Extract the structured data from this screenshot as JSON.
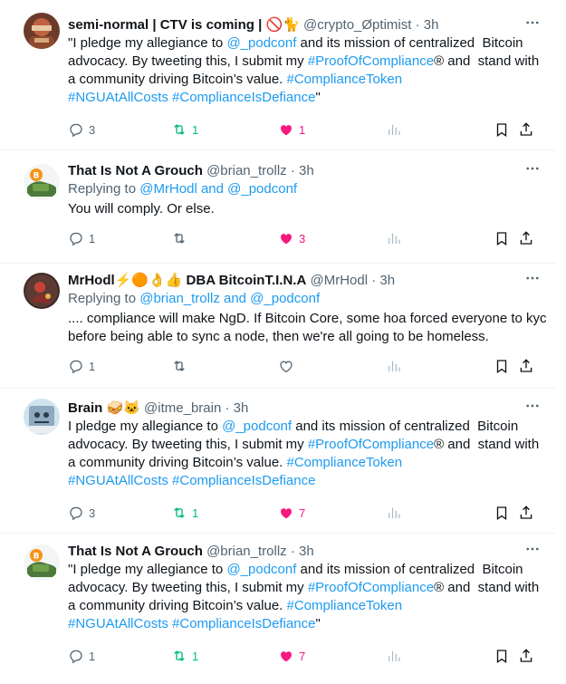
{
  "tweets": [
    {
      "name": "semi-normal | CTV is coming | 🚫🐈",
      "handle": "@crypto_Øptimist",
      "dot": "·",
      "time": "3h",
      "replying_prefix": "",
      "replying_users": "",
      "body": [
        {
          "t": "\"I pledge my allegiance to ",
          "link": false
        },
        {
          "t": "@_podconf",
          "link": true
        },
        {
          "t": " and its mission of centralized  Bitcoin advocacy. By tweeting this, I submit my ",
          "link": false
        },
        {
          "t": "#ProofOfCompliance",
          "link": true
        },
        {
          "t": "® and  stand with a community driving Bitcoin’s value. ",
          "link": false
        },
        {
          "t": "#ComplianceToken",
          "link": true
        },
        {
          "t": "\n",
          "link": false
        },
        {
          "t": "#NGUAtAllCosts",
          "link": true
        },
        {
          "t": " ",
          "link": false
        },
        {
          "t": "#ComplianceIsDefiance",
          "link": true
        },
        {
          "t": "\"",
          "link": false
        }
      ],
      "replies": "3",
      "retweets": "1",
      "likes": "1",
      "liked": true,
      "retweeted": true,
      "avatar": "brown-knight-avatar"
    },
    {
      "name": "That Is Not A Grouch",
      "handle": "@brian_trollz",
      "dot": "·",
      "time": "3h",
      "replying_prefix": "Replying to ",
      "replying_users": "@MrHodl and @_podconf",
      "body": [
        {
          "t": "You will comply. Or else.",
          "link": false
        }
      ],
      "replies": "1",
      "retweets": "",
      "likes": "3",
      "liked": true,
      "retweeted": false,
      "avatar": "grouch-bitcoin-avatar"
    },
    {
      "name": "MrHodl⚡🟠👌👍 DBA BitcoinT.I.N.A",
      "handle": "@MrHodl",
      "dot": "·",
      "time": "3h",
      "replying_prefix": "Replying to ",
      "replying_users": "@brian_trollz and @_podconf",
      "body": [
        {
          "t": ".... compliance will make NgD. If Bitcoin Core, some hoa forced everyone to kyc before being able to sync a node, then we're all going to be homeless.",
          "link": false
        }
      ],
      "replies": "1",
      "retweets": "",
      "likes": "",
      "liked": false,
      "retweeted": false,
      "avatar": "red-figure-avatar"
    },
    {
      "name": "Brain 🥪🐱",
      "handle": "@itme_brain",
      "dot": "·",
      "time": "3h",
      "replying_prefix": "",
      "replying_users": "",
      "body": [
        {
          "t": "I pledge my allegiance to ",
          "link": false
        },
        {
          "t": "@_podconf",
          "link": true
        },
        {
          "t": " and its mission of centralized  Bitcoin advocacy. By tweeting this, I submit my ",
          "link": false
        },
        {
          "t": "#ProofOfCompliance",
          "link": true
        },
        {
          "t": "® and  stand with a community driving Bitcoin’s value. ",
          "link": false
        },
        {
          "t": "#ComplianceToken",
          "link": true
        },
        {
          "t": "\n",
          "link": false
        },
        {
          "t": "#NGUAtAllCosts",
          "link": true
        },
        {
          "t": " ",
          "link": false
        },
        {
          "t": "#ComplianceIsDefiance",
          "link": true
        }
      ],
      "replies": "3",
      "retweets": "1",
      "likes": "7",
      "liked": true,
      "retweeted": true,
      "avatar": "cat-avatar"
    },
    {
      "name": "That Is Not A Grouch",
      "handle": "@brian_trollz",
      "dot": "·",
      "time": "3h",
      "replying_prefix": "",
      "replying_users": "",
      "body": [
        {
          "t": "\"I pledge my allegiance to ",
          "link": false
        },
        {
          "t": "@_podconf",
          "link": true
        },
        {
          "t": " and its mission of centralized  Bitcoin advocacy. By tweeting this, I submit my ",
          "link": false
        },
        {
          "t": "#ProofOfCompliance",
          "link": true
        },
        {
          "t": "® and  stand with a community driving Bitcoin’s value. ",
          "link": false
        },
        {
          "t": "#ComplianceToken",
          "link": true
        },
        {
          "t": "\n",
          "link": false
        },
        {
          "t": "#NGUAtAllCosts",
          "link": true
        },
        {
          "t": " ",
          "link": false
        },
        {
          "t": "#ComplianceIsDefiance",
          "link": true
        },
        {
          "t": "\"",
          "link": false
        }
      ],
      "replies": "1",
      "retweets": "1",
      "likes": "7",
      "liked": true,
      "retweeted": true,
      "avatar": "grouch-bitcoin-avatar"
    }
  ],
  "colors": {
    "link": "#1d9bf0",
    "secondary_text": "#536471",
    "like": "#f91880",
    "retweet": "#00ba7c",
    "divider": "#eff3f4"
  }
}
